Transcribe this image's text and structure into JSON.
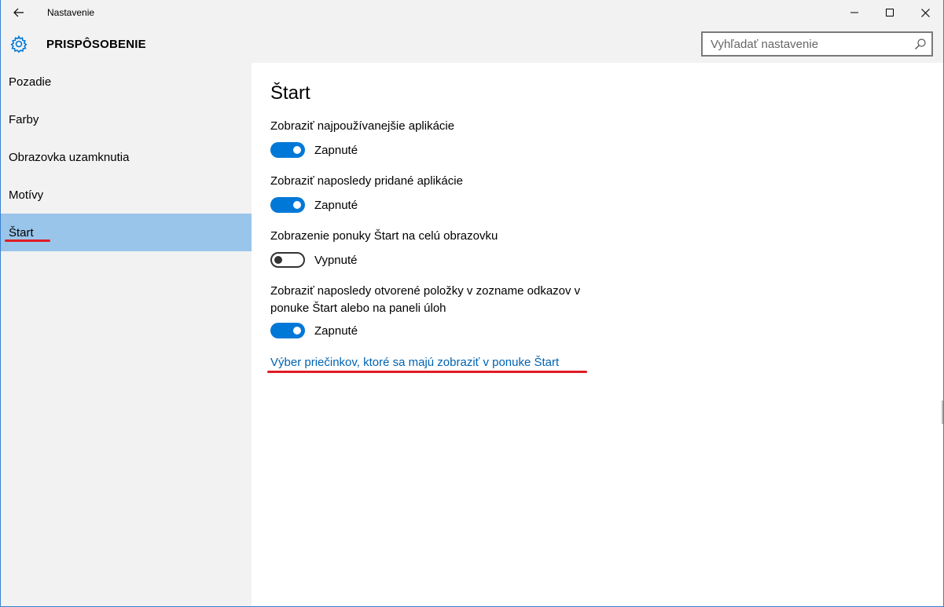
{
  "window": {
    "title": "Nastavenie"
  },
  "header": {
    "title": "PRISPÔSOBENIE",
    "search_placeholder": "Vyhľadať nastavenie"
  },
  "sidebar": {
    "items": [
      {
        "label": "Pozadie",
        "selected": false
      },
      {
        "label": "Farby",
        "selected": false
      },
      {
        "label": "Obrazovka uzamknutia",
        "selected": false
      },
      {
        "label": "Motívy",
        "selected": false
      },
      {
        "label": "Štart",
        "selected": true
      }
    ]
  },
  "main": {
    "title": "Štart",
    "settings": [
      {
        "label": "Zobraziť najpoužívanejšie aplikácie",
        "state": "Zapnuté",
        "on": true
      },
      {
        "label": "Zobraziť naposledy pridané aplikácie",
        "state": "Zapnuté",
        "on": true
      },
      {
        "label": "Zobrazenie ponuky Štart na celú obrazovku",
        "state": "Vypnuté",
        "on": false
      },
      {
        "label": "Zobraziť naposledy otvorené položky v zozname odkazov v ponuke Štart alebo na paneli úloh",
        "state": "Zapnuté",
        "on": true
      }
    ],
    "link": "Výber priečinkov, ktoré sa majú zobraziť v ponuke Štart"
  },
  "colors": {
    "accent": "#0078d7",
    "selected_nav": "#99c5eb",
    "link": "#0063b1",
    "annotation": "#e01b24"
  },
  "icons": {
    "back": "back-arrow-icon",
    "gear": "gear-icon",
    "search": "search-icon",
    "minimize": "minimize-icon",
    "maximize": "maximize-icon",
    "close": "close-icon"
  }
}
